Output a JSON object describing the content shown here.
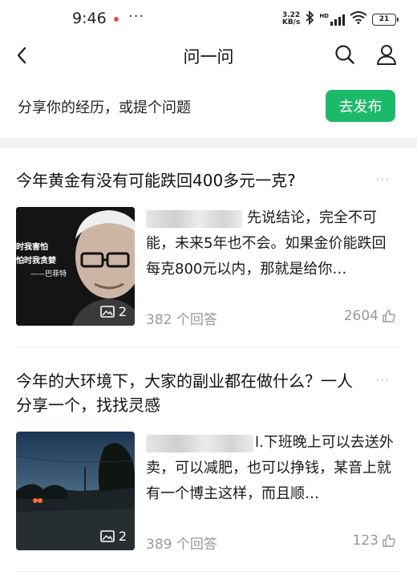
{
  "status_bar": {
    "time": "9:46",
    "more": "···",
    "net_speed_value": "3.22",
    "net_speed_unit": "KB/s",
    "hd_label": "HD",
    "battery": "21"
  },
  "nav": {
    "title": "问一问"
  },
  "compose": {
    "prompt": "分享你的经历，或提个问题",
    "publish_label": "去发布",
    "accent_color": "#1db96a"
  },
  "feed": [
    {
      "title": "今年黄金有没有可能跌回400多元一克?",
      "excerpt_first": "先说结论，完全不可",
      "excerpt_rest": "能，未来5年也不会。如果金价能跌回每克800元以内，那就是给你…",
      "image_count": "2",
      "answers": "382 个回答",
      "likes": "2604",
      "thumb_caption_1": "时我害怕",
      "thumb_caption_2": "怕时我贪婪",
      "thumb_caption_3": "——巴菲特"
    },
    {
      "title": "今年的大环境下，大家的副业都在做什么？一人分享一个，找找灵感",
      "excerpt_first": "l.下班晚上可以去送",
      "excerpt_rest": "外卖，可以减肥，也可以挣钱，某音上就有一个博主这样，而且顺…",
      "image_count": "2",
      "answers": "389 个回答",
      "likes": "123"
    }
  ],
  "icons": {
    "back": "chevron-left-icon",
    "search": "search-icon",
    "profile": "user-icon",
    "image_count": "image-icon",
    "like": "thumbs-up-icon"
  }
}
